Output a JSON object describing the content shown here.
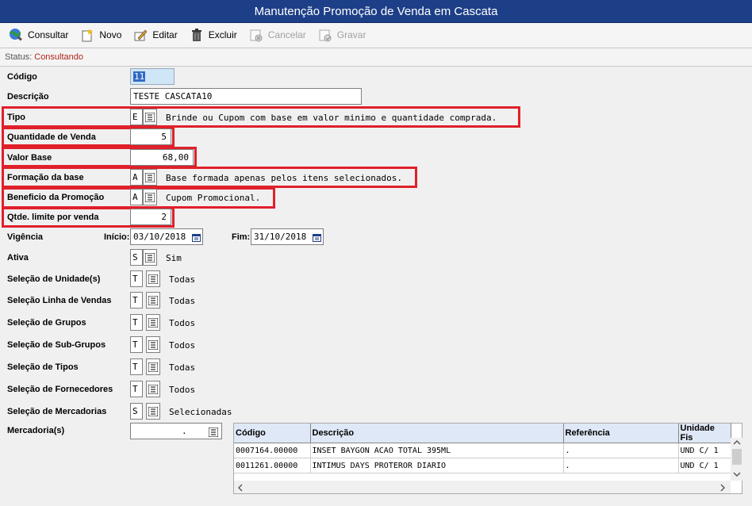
{
  "window": {
    "title": "Manutenção Promoção de Venda em Cascata"
  },
  "toolbar": {
    "consultar": "Consultar",
    "novo": "Novo",
    "editar": "Editar",
    "excluir": "Excluir",
    "cancelar": "Cancelar",
    "gravar": "Gravar"
  },
  "status": {
    "label": "Status:",
    "value": "Consultando"
  },
  "form": {
    "codigo": {
      "label": "Código",
      "value": "11"
    },
    "descricao": {
      "label": "Descrição",
      "value": "TESTE CASCATA10"
    },
    "tipo": {
      "label": "Tipo",
      "code": "E",
      "desc": "Brinde ou Cupom com base em valor minimo e quantidade comprada."
    },
    "quantidade_venda": {
      "label": "Quantidade de Venda",
      "value": "5"
    },
    "valor_base": {
      "label": "Valor Base",
      "value": "68,00"
    },
    "formacao_base": {
      "label": "Formação da base",
      "code": "A",
      "desc": "Base formada apenas pelos itens selecionados."
    },
    "beneficio": {
      "label": "Beneficio da Promoção",
      "code": "A",
      "desc": "Cupom Promocional."
    },
    "qtde_limite": {
      "label": "Qtde. limite por venda",
      "value": "2"
    },
    "vigencia": {
      "label": "Vigência",
      "inicio_label": "Início:",
      "inicio": "03/10/2018",
      "fim_label": "Fim:",
      "fim": "31/10/2018"
    },
    "ativa": {
      "label": "Ativa",
      "code": "S",
      "desc": "Sim"
    },
    "sel_unidade": {
      "label": "Seleção de Unidade(s)",
      "code": "T",
      "desc": "Todas"
    },
    "sel_linha": {
      "label": "Seleção Linha de Vendas",
      "code": "T",
      "desc": "Todas"
    },
    "sel_grupos": {
      "label": "Seleção de Grupos",
      "code": "T",
      "desc": "Todos"
    },
    "sel_subgrupos": {
      "label": "Seleção de Sub-Grupos",
      "code": "T",
      "desc": "Todos"
    },
    "sel_tipos": {
      "label": "Seleção de Tipos",
      "code": "T",
      "desc": "Todas"
    },
    "sel_fornecedores": {
      "label": "Seleção de Fornecedores",
      "code": "T",
      "desc": "Todos"
    },
    "sel_mercadorias": {
      "label": "Seleção de Mercadorias",
      "code": "S",
      "desc": "Selecionadas"
    },
    "mercadorias": {
      "label": "Mercadoria(s)",
      "value": "."
    }
  },
  "grid": {
    "columns": [
      "Código",
      "Descrição",
      "Referência",
      "Unidade Fis"
    ],
    "rows": [
      [
        "0007164.00000",
        "INSET BAYGON ACAO TOTAL 395ML",
        ".",
        "UND C/ 1"
      ],
      [
        "0011261.00000",
        "INTIMUS DAYS PROTEROR DIARIO",
        ".",
        "UND C/ 1"
      ]
    ]
  },
  "colors": {
    "title_bg": "#1d3f87",
    "highlight": "#e0202a",
    "status_value": "#b0261c"
  }
}
